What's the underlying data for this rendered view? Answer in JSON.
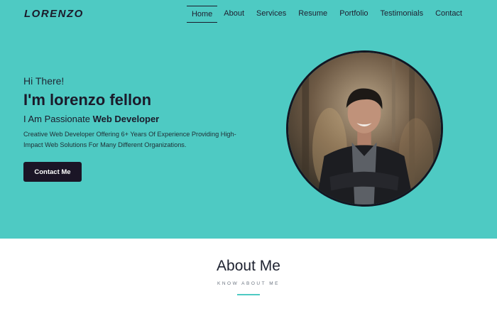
{
  "logo": "LORENZO",
  "nav": {
    "items": [
      {
        "label": "Home",
        "active": true
      },
      {
        "label": "About",
        "active": false
      },
      {
        "label": "Services",
        "active": false
      },
      {
        "label": "Resume",
        "active": false
      },
      {
        "label": "Portfolio",
        "active": false
      },
      {
        "label": "Testimonials",
        "active": false
      },
      {
        "label": "Contact",
        "active": false
      }
    ]
  },
  "hero": {
    "greeting": "Hi There!",
    "name": "I'm lorenzo fellon",
    "subtitle_prefix": "I Am Passionate ",
    "subtitle_bold": "Web Developer",
    "description": "Creative Web Developer Offering 6+ Years Of Experience Providing High-Impact Web Solutions For Many Different Organizations.",
    "cta_label": "Contact Me",
    "background_color": "#4ecac3",
    "photo": "profile-photo"
  },
  "about": {
    "title": "About Me",
    "subtitle": "KNOW ABOUT ME"
  },
  "colors": {
    "accent": "#4ecac3",
    "dark": "#1b1526"
  }
}
